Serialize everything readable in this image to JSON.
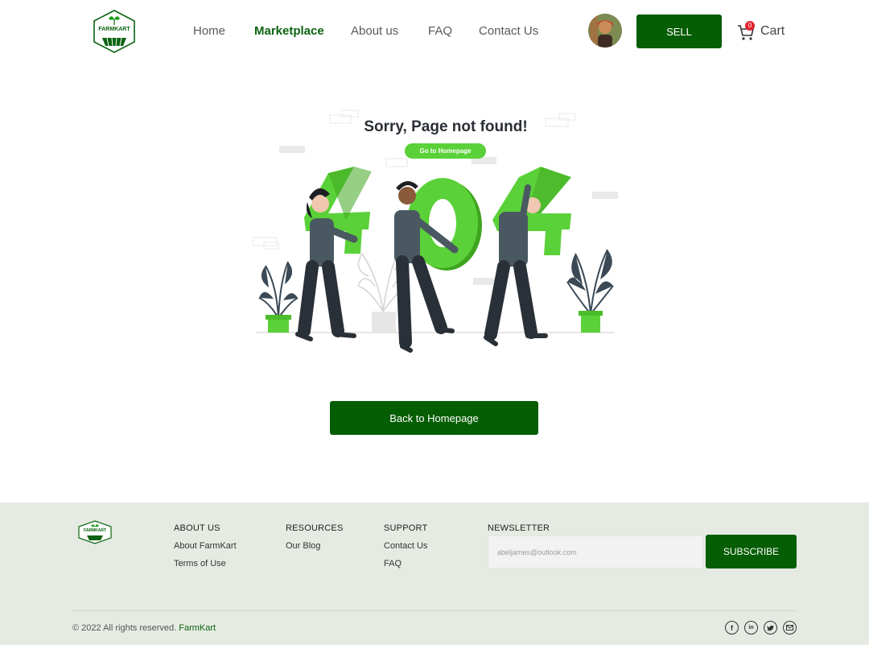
{
  "header": {
    "logo_text": "FARMKART",
    "nav": [
      {
        "label": "Home",
        "active": false
      },
      {
        "label": "Marketplace",
        "active": true
      },
      {
        "label": "About us",
        "active": false
      },
      {
        "label": "FAQ",
        "active": false
      },
      {
        "label": "Contact Us",
        "active": false
      }
    ],
    "sell_label": "SELL",
    "cart_label": "Cart",
    "cart_count": "0"
  },
  "main": {
    "illustration": {
      "title": "Sorry, Page not found!",
      "pill_label": "Go to Homepage"
    },
    "back_button": "Back to Homepage"
  },
  "footer": {
    "logo_text": "FARMKART",
    "columns": [
      {
        "heading": "ABOUT US",
        "links": [
          "About FarmKart",
          "Terms of Use"
        ]
      },
      {
        "heading": "RESOURCES",
        "links": [
          "Our Blog"
        ]
      },
      {
        "heading": "SUPPORT",
        "links": [
          "Contact Us",
          "FAQ"
        ]
      }
    ],
    "newsletter": {
      "heading": "NEWSLETTER",
      "placeholder": "abeljames@outlook.com",
      "button": "SUBSCRIBE"
    },
    "copyright": "© 2022 All rights reserved.",
    "brand": "FarmKart",
    "social_icons": [
      "facebook-icon",
      "linkedin-icon",
      "twitter-icon",
      "mail-icon"
    ]
  },
  "colors": {
    "primary": "#055d04",
    "accent_green": "#5ad138",
    "footer_bg": "#e5ebe2",
    "badge": "#e0262f"
  }
}
